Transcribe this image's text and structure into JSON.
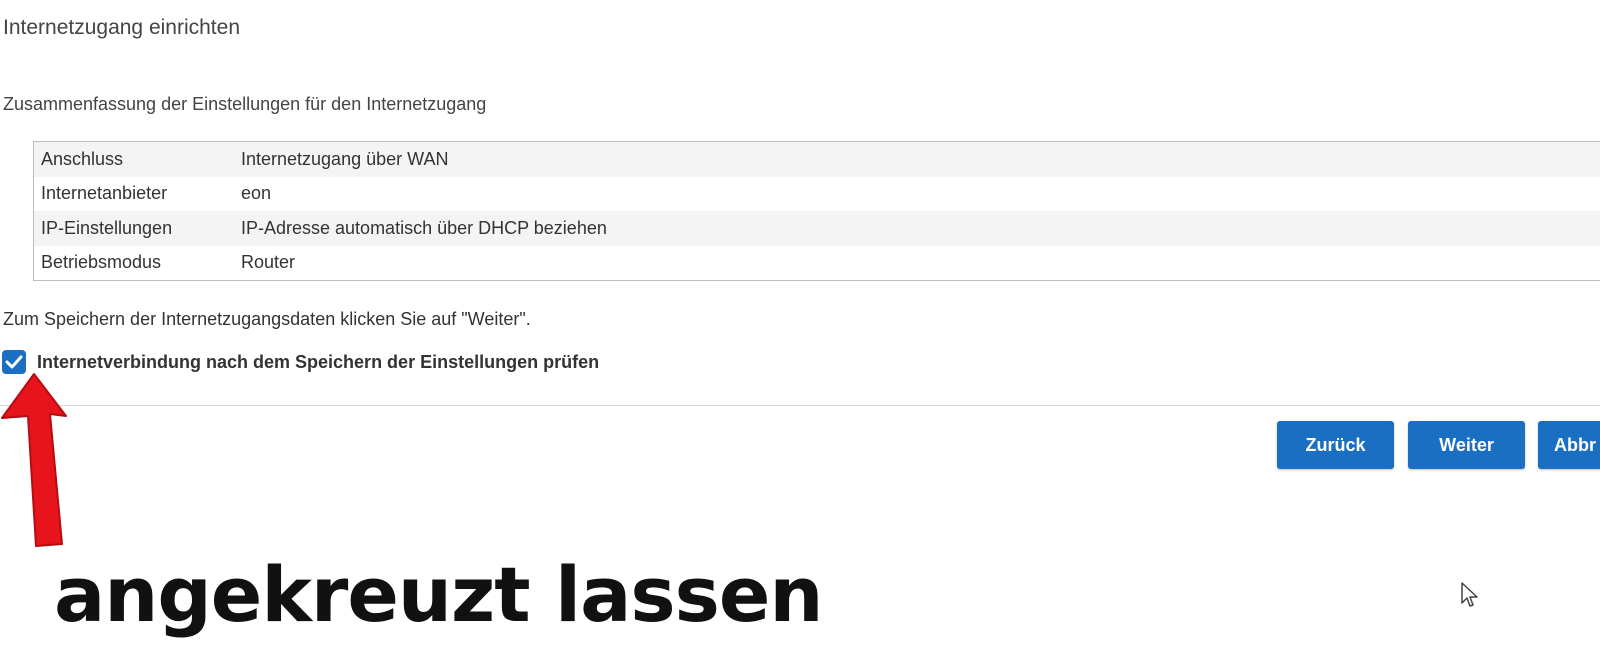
{
  "header": {
    "title": "Internetzugang einrichten"
  },
  "summary": {
    "heading": "Zusammenfassung der Einstellungen für den Internetzugang",
    "rows": [
      {
        "label": "Anschluss",
        "value": "Internetzugang über WAN"
      },
      {
        "label": "Internetanbieter",
        "value": "eon"
      },
      {
        "label": "IP-Einstellungen",
        "value": "IP-Adresse automatisch über DHCP beziehen"
      },
      {
        "label": "Betriebsmodus",
        "value": "Router"
      }
    ]
  },
  "save_hint": "Zum Speichern der Internetzugangsdaten klicken Sie auf \"Weiter\".",
  "check_connection": {
    "label": "Internetverbindung nach dem Speichern der Einstellungen prüfen",
    "checked": true
  },
  "buttons": {
    "back": "Zurück",
    "next": "Weiter",
    "cancel": "Abbr"
  },
  "annotation": {
    "text": "angekreuzt lassen",
    "arrow_icon": "red-arrow-up-icon"
  },
  "colors": {
    "accent": "#1a6fc3",
    "annotation_arrow": "#e8141b"
  },
  "icons": {
    "checkbox": "checkmark-icon",
    "cursor": "mouse-pointer-icon"
  }
}
